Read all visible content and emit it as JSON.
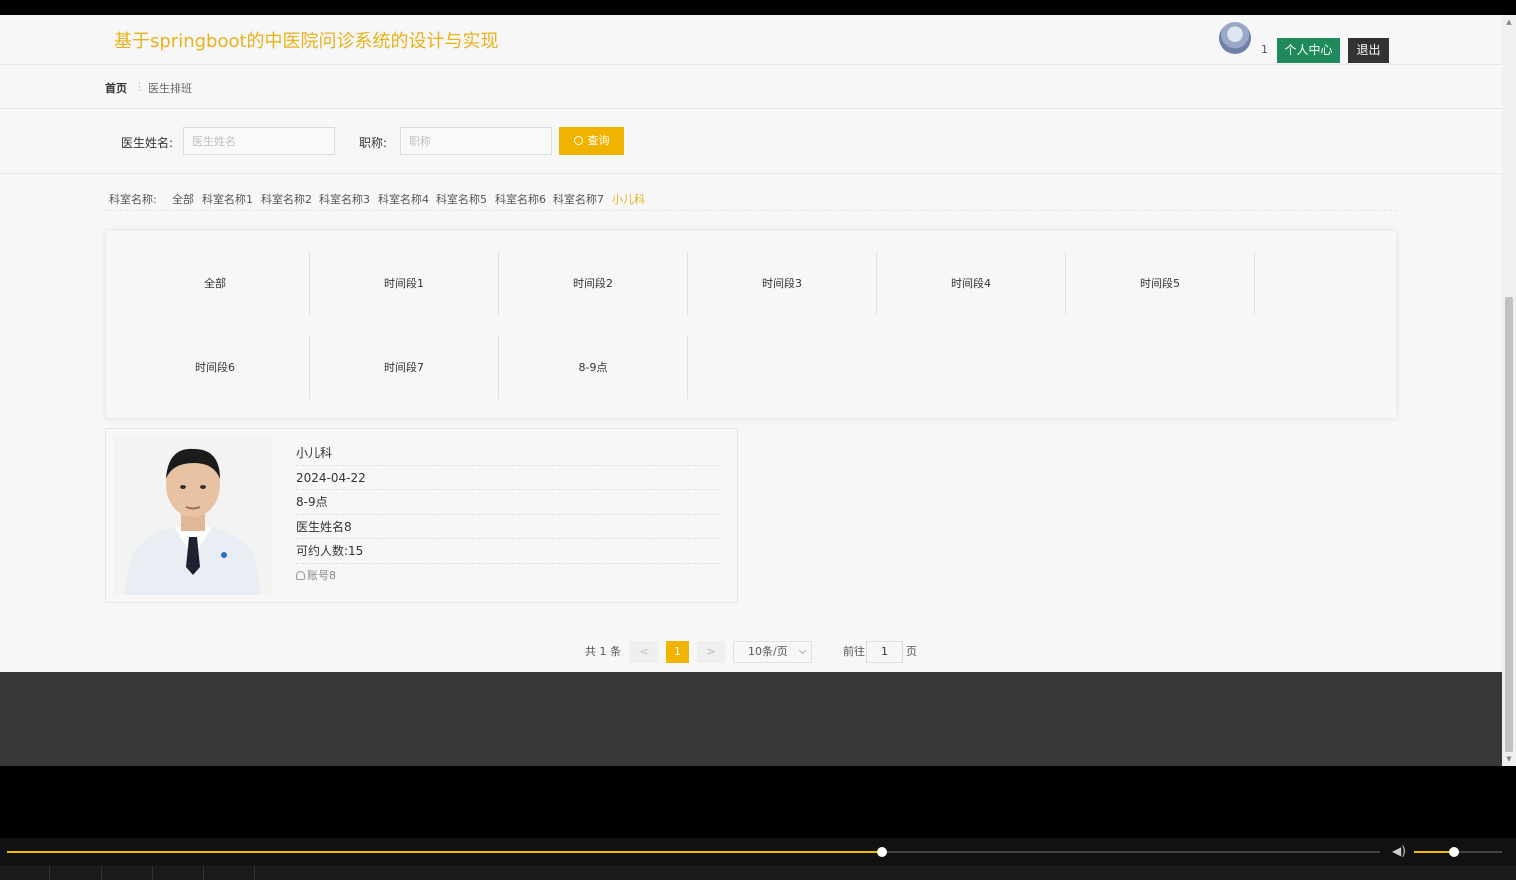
{
  "header": {
    "site_title": "基于springboot的中医院问诊系统的设计与实现",
    "username": "1",
    "personal_center_label": "个人中心",
    "logout_label": "退出"
  },
  "breadcrumb": {
    "home": "首页",
    "separator": "⋮",
    "current": "医生排班"
  },
  "search": {
    "doctor_name_label": "医生姓名:",
    "doctor_name_placeholder": "医生姓名",
    "title_label": "职称:",
    "title_placeholder": "职称",
    "query_label": "查询"
  },
  "departments": {
    "label": "科室名称:",
    "items": [
      "全部",
      "科室名称1",
      "科室名称2",
      "科室名称3",
      "科室名称4",
      "科室名称5",
      "科室名称6",
      "科室名称7",
      "小儿科"
    ],
    "active": "小儿科"
  },
  "time_slots": [
    "全部",
    "时间段1",
    "时间段2",
    "时间段3",
    "时间段4",
    "时间段5",
    "时间段6",
    "时间段7",
    "8-9点"
  ],
  "schedule": {
    "department": "小儿科",
    "date": "2024-04-22",
    "time_slot": "8-9点",
    "doctor_name": "医生姓名8",
    "capacity": "可约人数:15",
    "account": "账号8"
  },
  "pagination": {
    "total": "共 1 条",
    "prev": "<",
    "current": "1",
    "next": ">",
    "page_size": "10条/页",
    "goto_label": "前往",
    "goto_value": "1",
    "page_suffix": "页"
  },
  "player": {
    "progress": 0.637,
    "volume": 0.45
  },
  "colors": {
    "accent": "#f0b400",
    "title": "#e8b21b",
    "green_button": "#1f8a5b",
    "dark_button": "#333333",
    "footer": "#383838"
  }
}
